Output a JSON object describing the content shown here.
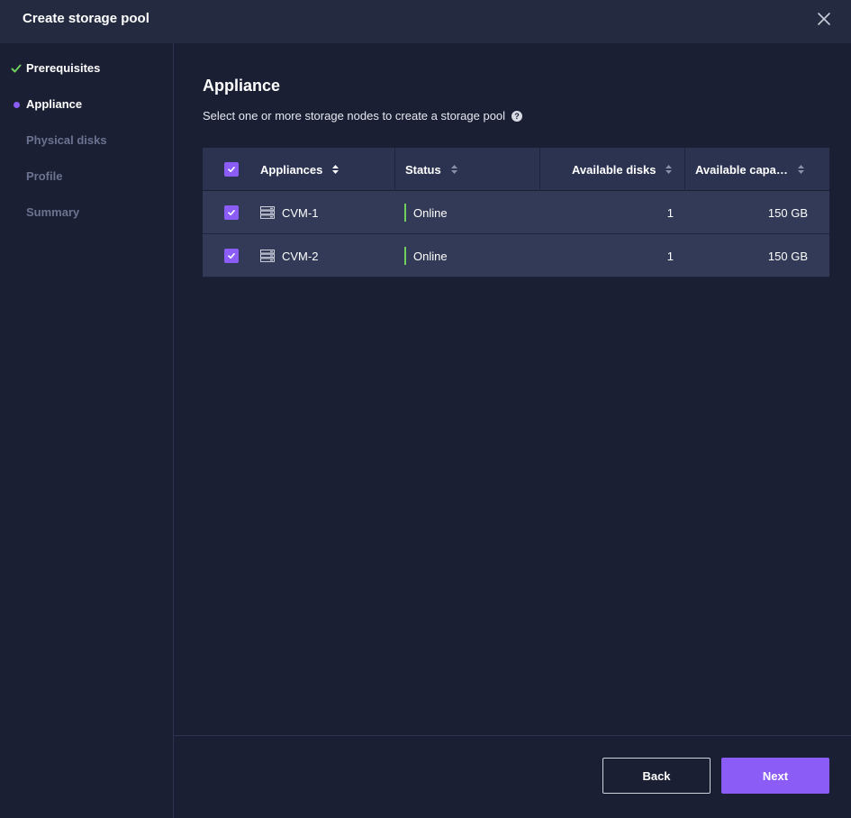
{
  "dialog": {
    "title": "Create storage pool"
  },
  "steps": [
    {
      "label": "Prerequisites",
      "state": "done"
    },
    {
      "label": "Appliance",
      "state": "active"
    },
    {
      "label": "Physical disks",
      "state": "pending"
    },
    {
      "label": "Profile",
      "state": "pending"
    },
    {
      "label": "Summary",
      "state": "pending"
    }
  ],
  "main": {
    "heading": "Appliance",
    "subtitle": "Select one or more storage nodes to create a storage pool"
  },
  "table": {
    "headers": {
      "appliances": "Appliances",
      "status": "Status",
      "available_disks": "Available disks",
      "available_capacity": "Available capa…"
    },
    "rows": [
      {
        "name": "CVM-1",
        "status": "Online",
        "disks": "1",
        "capacity": "150 GB",
        "checked": true
      },
      {
        "name": "CVM-2",
        "status": "Online",
        "disks": "1",
        "capacity": "150 GB",
        "checked": true
      }
    ]
  },
  "footer": {
    "back_label": "Back",
    "next_label": "Next"
  },
  "colors": {
    "accent": "#8b5cf6",
    "online": "#6fd05c",
    "done_check": "#6fd05c"
  }
}
